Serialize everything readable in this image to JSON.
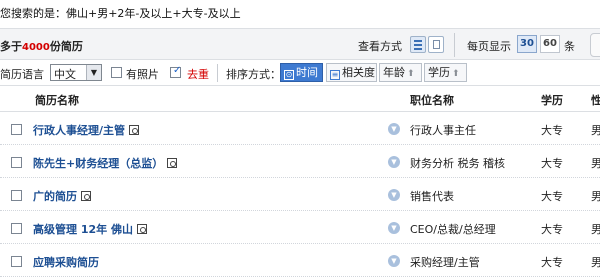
{
  "search": {
    "summary": "您搜索的是：佛山+男+2年-及以上+大专-及以上"
  },
  "toolbar": {
    "count_prefix": "多于",
    "count_value": "4000",
    "count_suffix": "份简历",
    "view_label": "查看方式",
    "per_page_label": "每页显示",
    "per_page_options": [
      "30",
      "60"
    ],
    "per_page_selected": "30",
    "per_page_unit": "条"
  },
  "filters": {
    "lang_label": "简历语言",
    "lang_value": "中文",
    "photo_label": "有照片",
    "photo_checked": false,
    "dedup_label": "去重",
    "dedup_checked": true,
    "sort_label": "排序方式：",
    "sort_time": "时间",
    "sort_relevance": "相关度",
    "sort_age": "年龄",
    "sort_education": "学历",
    "sort_active": "时间"
  },
  "table": {
    "headers": {
      "name": "简历名称",
      "job": "职位名称",
      "education": "学历",
      "gender": "性"
    },
    "rows": [
      {
        "name": "行政人事经理/主管",
        "job": "行政人事主任",
        "education": "大专",
        "gender": "男"
      },
      {
        "name": "陈先生+财务经理（总监）",
        "job": "财务分析  税务  稽核",
        "education": "大专",
        "gender": "男"
      },
      {
        "name": "广的简历",
        "job": "销售代表",
        "education": "大专",
        "gender": "男"
      },
      {
        "name": "高级管理  12年  佛山",
        "job": "CEO/总裁/总经理",
        "education": "大专",
        "gender": "男"
      },
      {
        "name": "应聘采购简历",
        "job": "采购经理/主管",
        "education": "大专",
        "gender": "男"
      }
    ]
  },
  "icons": {
    "view_list": "list-view-icon",
    "view_grid": "grid-view-icon",
    "resume": "resume-icon",
    "expand": "chevron-down-icon"
  },
  "colors": {
    "link": "#1d4f93",
    "accent": "#3e7ad1",
    "highlight_red": "#d40000"
  }
}
